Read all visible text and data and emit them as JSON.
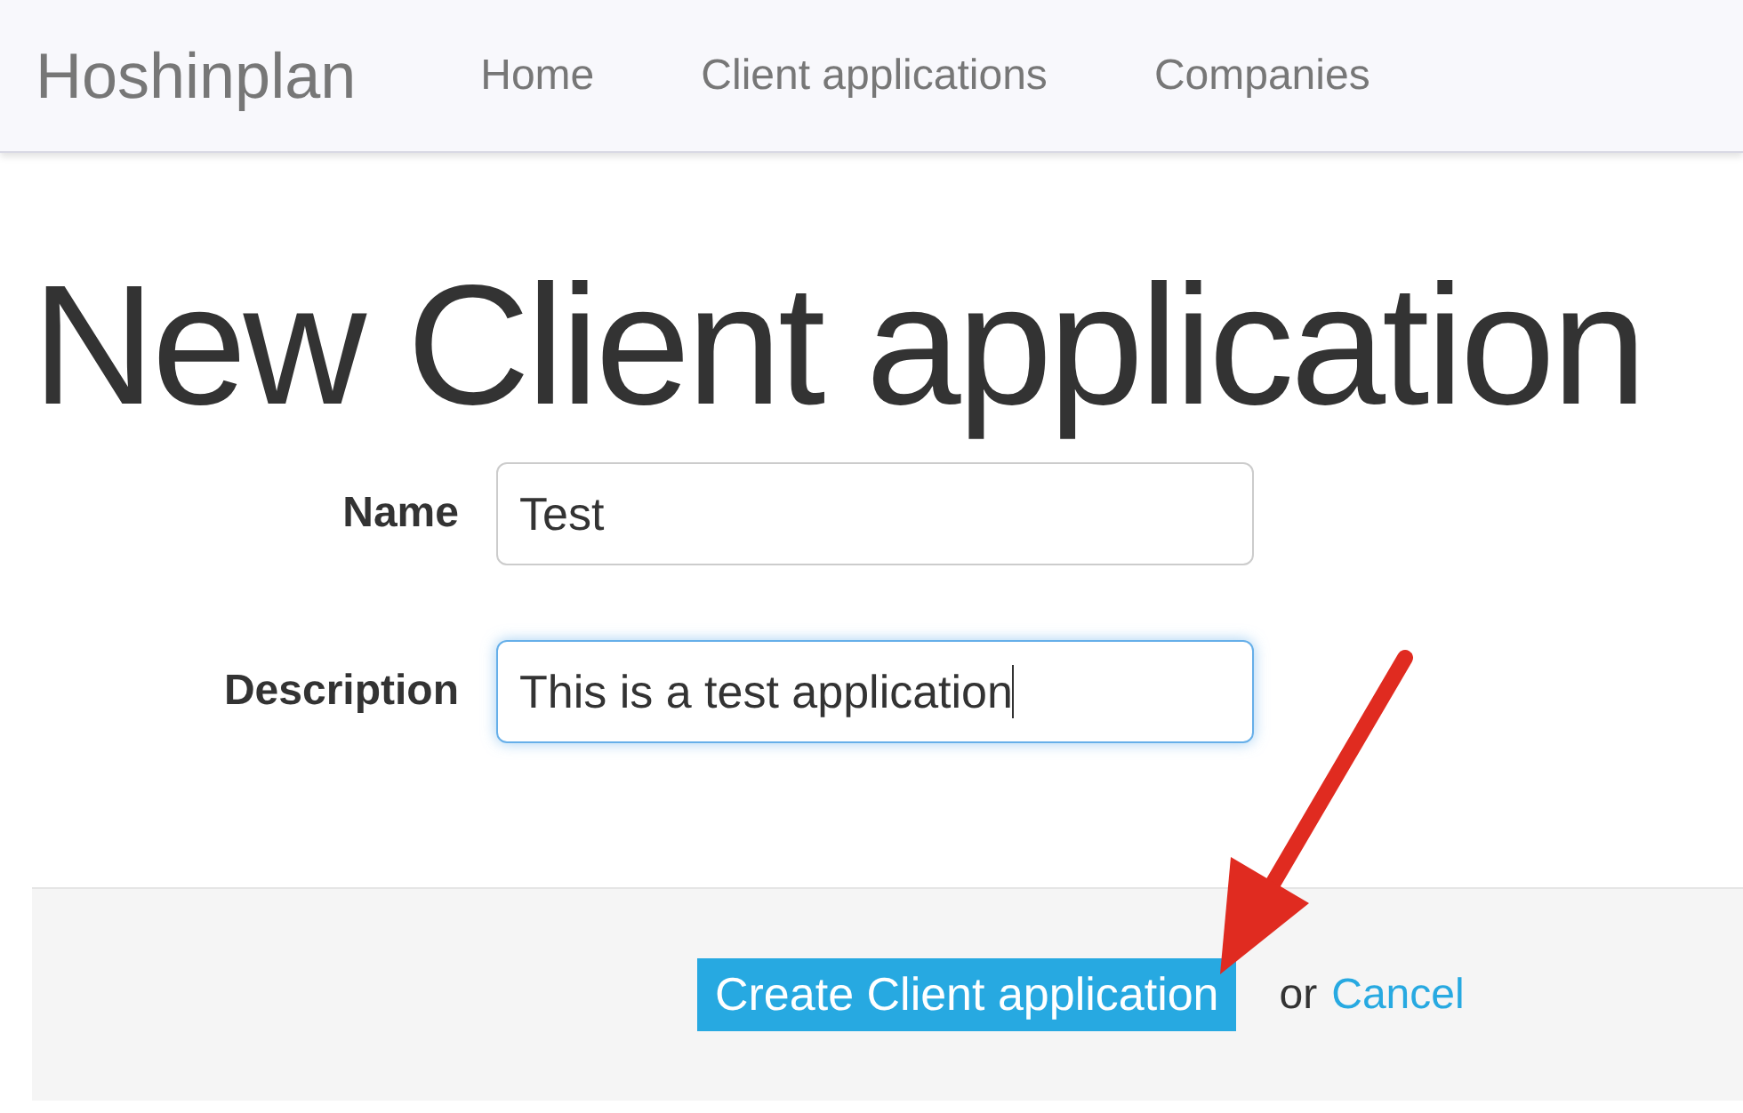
{
  "navbar": {
    "brand": "Hoshinplan",
    "links": [
      "Home",
      "Client applications",
      "Companies"
    ]
  },
  "page_title": "New Client application",
  "form": {
    "fields": [
      {
        "label": "Name",
        "value": "Test",
        "focused": false
      },
      {
        "label": "Description",
        "value": "This is a test application",
        "focused": true
      }
    ],
    "actions": {
      "submit": "Create Client application",
      "separator": "or",
      "cancel": "Cancel"
    }
  }
}
